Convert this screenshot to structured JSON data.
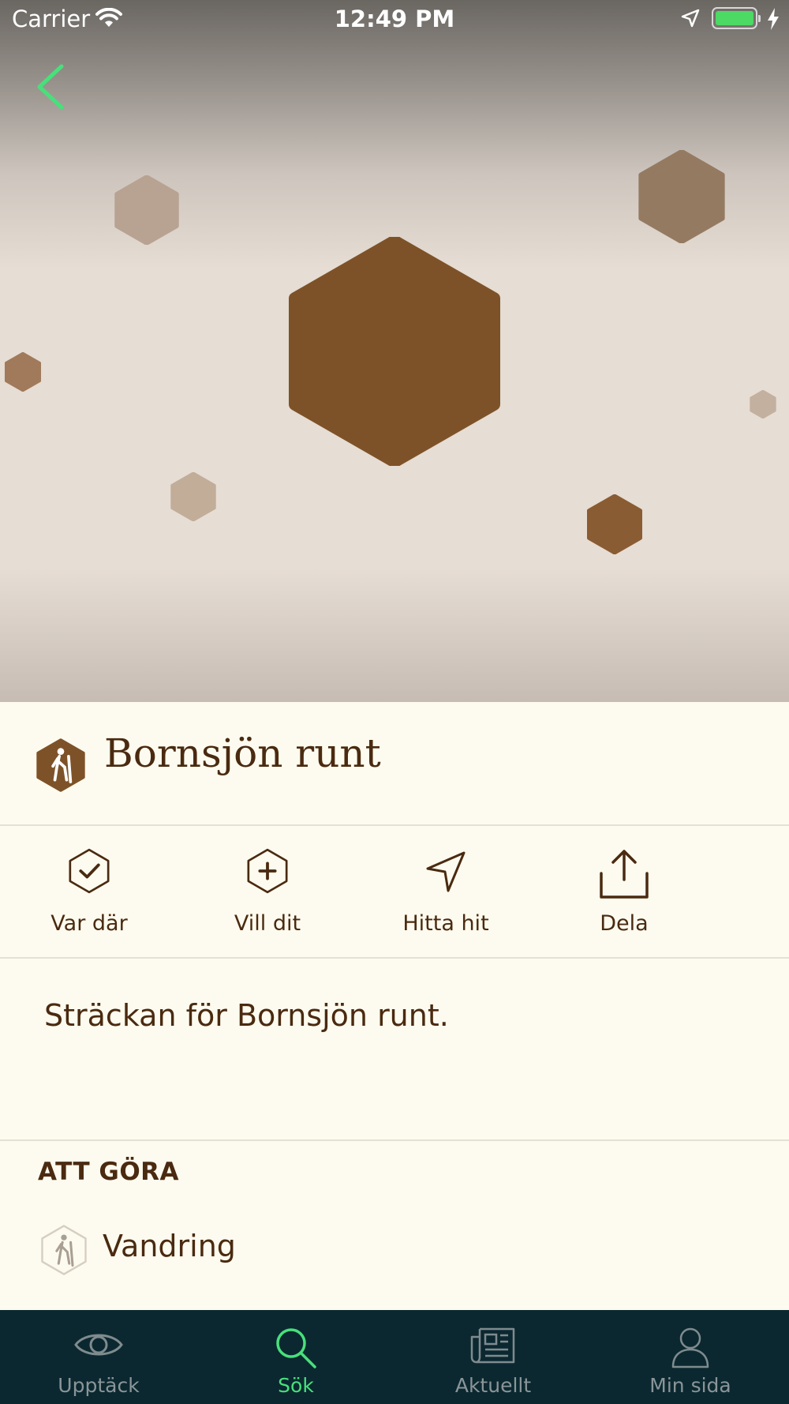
{
  "status_bar": {
    "carrier": "Carrier",
    "time": "12:49 PM"
  },
  "place": {
    "title": "Bornsjön runt",
    "icon": "hiker-icon"
  },
  "actions": [
    {
      "label": "Var där",
      "icon": "hex-check-icon"
    },
    {
      "label": "Vill dit",
      "icon": "hex-plus-icon"
    },
    {
      "label": "Hitta hit",
      "icon": "navigation-arrow-icon"
    },
    {
      "label": "Dela",
      "icon": "share-icon"
    }
  ],
  "description": "Sträckan för Bornsjön runt.",
  "todo": {
    "heading": "ATT GÖRA",
    "items": [
      {
        "label": "Vandring",
        "icon": "hiker-icon"
      }
    ]
  },
  "tabs": [
    {
      "label": "Upptäck",
      "icon": "eye-icon",
      "active": false
    },
    {
      "label": "Sök",
      "icon": "search-icon",
      "active": true
    },
    {
      "label": "Aktuellt",
      "icon": "newspaper-icon",
      "active": false
    },
    {
      "label": "Min sida",
      "icon": "person-icon",
      "active": false
    }
  ],
  "colors": {
    "accent_green": "#48e07a",
    "brown": "#7e5228",
    "text_brown": "#4a2a10",
    "tab_bar_bg": "#0b2830",
    "content_bg": "#FDFBEF"
  }
}
